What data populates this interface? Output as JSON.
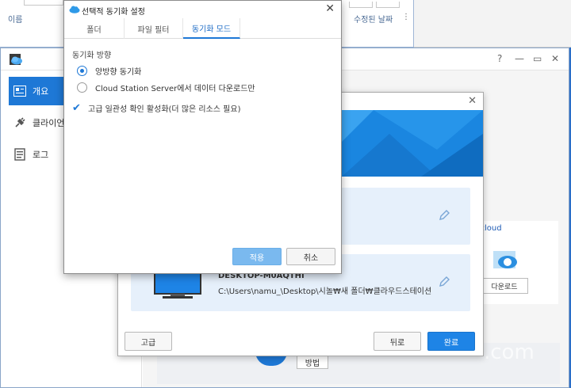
{
  "explorer": {
    "col_name": "이름",
    "col_modified": "수정된 날짜",
    "sort_icon": "more-vertical-icon"
  },
  "main_window": {
    "controls": [
      "?",
      "—",
      "▭",
      "✕"
    ],
    "sidebar": [
      {
        "label": "개요",
        "icon": "overview-icon",
        "active": true
      },
      {
        "label": "클라이언트",
        "icon": "plug-icon",
        "active": false
      },
      {
        "label": "로그",
        "icon": "log-icon",
        "active": false
      }
    ],
    "right_card_title": "S cloud",
    "right_card_button": "다운로드",
    "setup_button": "방법"
  },
  "wizard": {
    "device_name": "DESKTOP-M0AQTHI",
    "device_path": "C:\\Users\\namu_\\Desktop\\시놀₩새 폴더₩클라우드스테이션",
    "advanced_button": "고급",
    "back_button": "뒤로",
    "finish_button": "완료",
    "colors": {
      "primary": "#1e84e6",
      "banner": "#1a86e0"
    }
  },
  "dialog": {
    "title": "선택적 동기화 설정",
    "tabs": [
      {
        "label": "폴더",
        "active": false
      },
      {
        "label": "파일 필터",
        "active": false
      },
      {
        "label": "동기화 모드",
        "active": true
      }
    ],
    "section_label": "동기화 방향",
    "options": [
      {
        "label": "양방향 동기화",
        "selected": true
      },
      {
        "label": "Cloud Station Server에서 데이터 다운로드만",
        "selected": false
      }
    ],
    "checkbox_label": "고급 일관성 확인 활성화(더 많은 리소스 필요)",
    "checkbox_checked": true,
    "apply_button": "적용",
    "cancel_button": "취소"
  }
}
